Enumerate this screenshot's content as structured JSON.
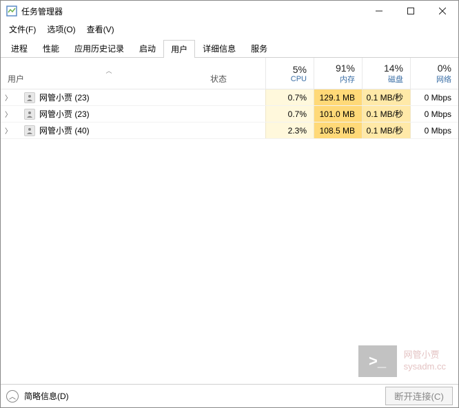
{
  "window": {
    "title": "任务管理器",
    "minimize": "—",
    "maximize": "▢",
    "close": "✕"
  },
  "menu": {
    "file": "文件(F)",
    "options": "选项(O)",
    "view": "查看(V)"
  },
  "tabs": {
    "processes": "进程",
    "performance": "性能",
    "app_history": "应用历史记录",
    "startup": "启动",
    "users": "用户",
    "details": "详细信息",
    "services": "服务"
  },
  "columns": {
    "user": "用户",
    "status": "状态",
    "cpu_pct": "5%",
    "cpu_lbl": "CPU",
    "mem_pct": "91%",
    "mem_lbl": "内存",
    "disk_pct": "14%",
    "disk_lbl": "磁盘",
    "net_pct": "0%",
    "net_lbl": "网络"
  },
  "rows": [
    {
      "name": "网管小贾 (23)",
      "cpu": "0.7%",
      "mem": "129.1 MB",
      "disk": "0.1 MB/秒",
      "net": "0 Mbps"
    },
    {
      "name": "网管小贾 (23)",
      "cpu": "0.7%",
      "mem": "101.0 MB",
      "disk": "0.1 MB/秒",
      "net": "0 Mbps"
    },
    {
      "name": "网管小贾 (40)",
      "cpu": "2.3%",
      "mem": "108.5 MB",
      "disk": "0.1 MB/秒",
      "net": "0 Mbps"
    }
  ],
  "watermark": {
    "prompt": ">_",
    "line1": "网管小贾",
    "line2": "sysadm.cc"
  },
  "footer": {
    "details_toggle": "简略信息(D)",
    "disconnect": "断开连接(C)"
  }
}
